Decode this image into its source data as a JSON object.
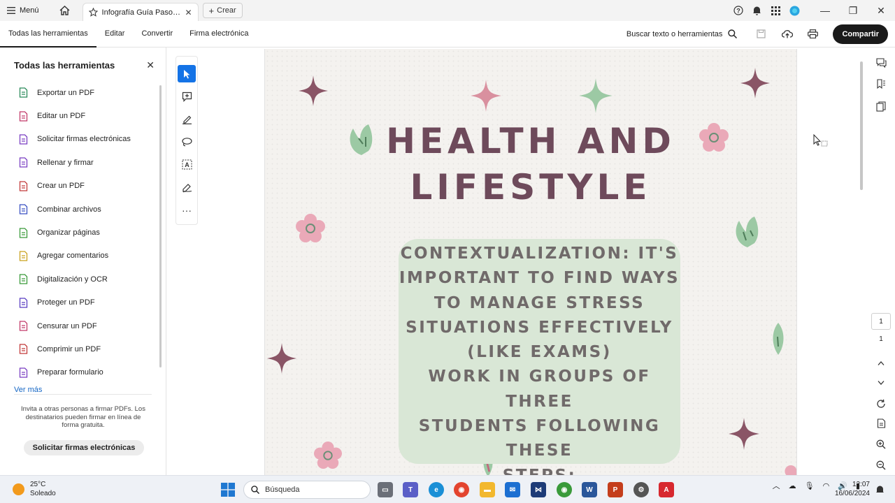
{
  "titlebar": {
    "menu_label": "Menú",
    "tab_title": "Infografía Guía Pasos...",
    "create_label": "Crear"
  },
  "toolbar": {
    "tabs": [
      "Todas las herramientas",
      "Editar",
      "Convertir",
      "Firma electrónica"
    ],
    "search_label": "Buscar texto o herramientas",
    "share_label": "Compartir"
  },
  "left_panel": {
    "title": "Todas las herramientas",
    "items": [
      {
        "label": "Exportar un PDF",
        "icon": "export-pdf-icon",
        "color": "#2b8a5a"
      },
      {
        "label": "Editar un PDF",
        "icon": "edit-pdf-icon",
        "color": "#c23b6a"
      },
      {
        "label": "Solicitar firmas electrónicas",
        "icon": "request-signatures-icon",
        "color": "#7a3fc2"
      },
      {
        "label": "Rellenar y firmar",
        "icon": "fill-sign-icon",
        "color": "#7a3fc2"
      },
      {
        "label": "Crear un PDF",
        "icon": "create-pdf-icon",
        "color": "#c23b3b"
      },
      {
        "label": "Combinar archivos",
        "icon": "combine-files-icon",
        "color": "#3a52c2"
      },
      {
        "label": "Organizar páginas",
        "icon": "organize-pages-icon",
        "color": "#3a9a3a"
      },
      {
        "label": "Agregar comentarios",
        "icon": "comment-icon",
        "color": "#c9a21f"
      },
      {
        "label": "Digitalización y OCR",
        "icon": "scan-ocr-icon",
        "color": "#3a9a3a"
      },
      {
        "label": "Proteger un PDF",
        "icon": "protect-pdf-icon",
        "color": "#5a3fc2"
      },
      {
        "label": "Censurar un PDF",
        "icon": "redact-pdf-icon",
        "color": "#c23b6a"
      },
      {
        "label": "Comprimir un PDF",
        "icon": "compress-pdf-icon",
        "color": "#c23b3b"
      },
      {
        "label": "Preparar formulario",
        "icon": "prepare-form-icon",
        "color": "#7a3fc2"
      }
    ],
    "more_label": "Ver más",
    "invite_text": "Invita a otras personas a firmar PDFs. Los destinatarios pueden firmar en línea de forma gratuita.",
    "invite_button": "Solicitar firmas electrónicas"
  },
  "document": {
    "title_line1": "HEALTH AND",
    "title_line2": "LIFESTYLE",
    "context_lines": [
      "CONTEXTUALIZATION: IT'S",
      "IMPORTANT TO FIND WAYS",
      "TO MANAGE STRESS",
      "SITUATIONS EFFECTIVELY",
      "(LIKE EXAMS)",
      "WORK IN GROUPS OF THREE",
      "STUDENTS FOLLOWING THESE",
      "STEPS:"
    ],
    "colors": {
      "title": "#6e4a5b",
      "box": "#d9e7d6",
      "text": "#706a6a",
      "star_dark": "#8a5566",
      "star_pink": "#d9909f",
      "star_green": "#9cc9a4",
      "leaf": "#9cc9a4",
      "flower": "#eaa9b8"
    }
  },
  "right_rail": {
    "current_page": "1",
    "total_pages": "1"
  },
  "taskbar": {
    "temperature": "25°C",
    "weather": "Soleado",
    "search_placeholder": "Búsqueda",
    "time": "12:07",
    "date": "16/06/2024"
  }
}
